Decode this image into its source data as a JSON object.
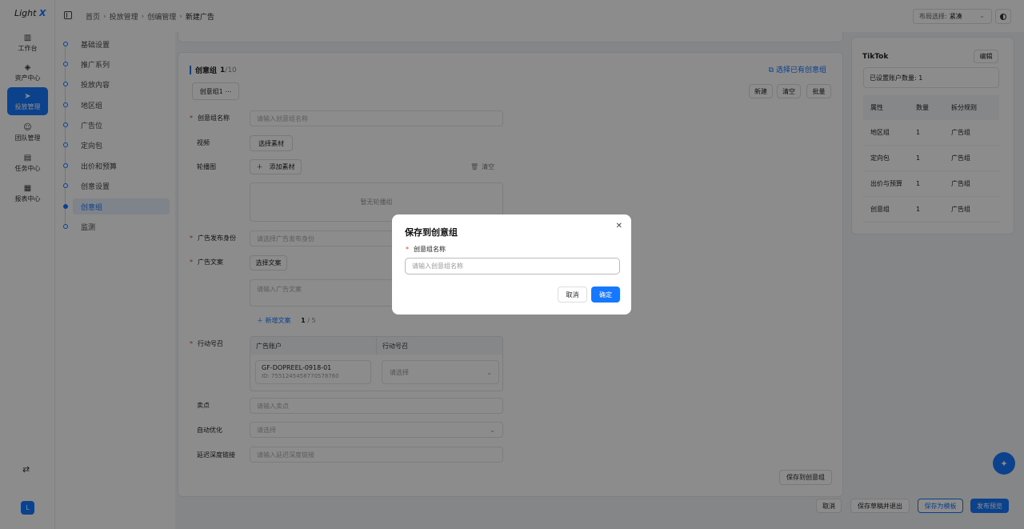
{
  "app": {
    "logo_main": "Light",
    "logo_x": "X"
  },
  "rail": {
    "items": [
      {
        "label": "工作台",
        "icon": "bar-chart-icon"
      },
      {
        "label": "资产中心",
        "icon": "layers-icon"
      },
      {
        "label": "投放管理",
        "icon": "send-icon"
      },
      {
        "label": "团队管理",
        "icon": "users-icon"
      },
      {
        "label": "任务中心",
        "icon": "clipboard-icon"
      },
      {
        "label": "报表中心",
        "icon": "report-icon"
      }
    ],
    "avatar": "L"
  },
  "breadcrumb": [
    "首页",
    "投放管理",
    "创编管理",
    "新建广告"
  ],
  "layout_select": {
    "label": "布局选择:",
    "value": "紧凑"
  },
  "steps": [
    "基础设置",
    "推广系列",
    "投放内容",
    "地区组",
    "广告位",
    "定向包",
    "出价和预算",
    "创意设置",
    "创意组",
    "监测"
  ],
  "card": {
    "title": "创意组",
    "count_current": "1",
    "count_total": "/10",
    "choose_existing": "选择已有创意组",
    "group_tab": "创意组1",
    "group_tab_more": "⋯",
    "btn_new": "新建",
    "btn_clear": "清空",
    "btn_batch": "批量",
    "fields": {
      "name_label": "创意组名称",
      "name_placeholder": "请输入创意组名称",
      "video_label": "视频",
      "video_btn": "选择素材",
      "carousel_label": "轮播图",
      "carousel_add": "添加素材",
      "carousel_clear": "清空",
      "carousel_empty": "暂无轮播组",
      "identity_label": "广告发布身份",
      "identity_placeholder": "请选择广告发布身份",
      "copy_label": "广告文案",
      "copy_btn": "选择文案",
      "copy_placeholder": "请输入广告文案",
      "add_copy": "新增文案",
      "copy_count_current": "1",
      "copy_count_total": " / 5",
      "cta_label": "行动号召",
      "cta_col_account": "广告账户",
      "cta_col_cta": "行动号召",
      "account_name": "GF-DOPREEL-0918-01",
      "account_id": "ID: 7551245458770578760",
      "cta_placeholder": "请选择",
      "selling_label": "卖点",
      "selling_placeholder": "请输入卖点",
      "auto_opt_label": "自动优化",
      "auto_opt_placeholder": "请选择",
      "deeplink_label": "延迟深度链接",
      "deeplink_placeholder": "请输入延迟深度链接",
      "save_to_group": "保存到创意组"
    }
  },
  "right_panel": {
    "title": "TikTok",
    "edit": "编辑",
    "info": "已设置账户数量: 1",
    "headers": [
      "属性",
      "数量",
      "拆分规则"
    ],
    "rows": [
      [
        "地区组",
        "1",
        "广告组"
      ],
      [
        "定向包",
        "1",
        "广告组"
      ],
      [
        "出价与预算",
        "1",
        "广告组"
      ],
      [
        "创意组",
        "1",
        "广告组"
      ]
    ]
  },
  "bottom": {
    "cancel": "取消",
    "save_draft": "保存草稿并退出",
    "save_template": "保存为模板",
    "publish_preview": "发布预览"
  },
  "modal": {
    "title": "保存到创意组",
    "field_label": "创意组名称",
    "placeholder": "请输入创意组名称",
    "cancel": "取消",
    "ok": "确定"
  },
  "colors": {
    "accent": "#1677ff",
    "required": "#e53935"
  }
}
